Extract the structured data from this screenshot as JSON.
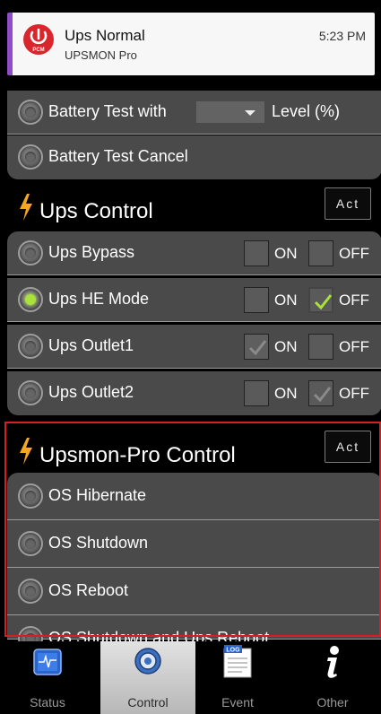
{
  "notification": {
    "title": "Ups Normal",
    "subtitle": "UPSMON Pro",
    "time": "5:23 PM",
    "icon_text": "PCM",
    "accent": "#8e4dc7"
  },
  "battery": {
    "test_with_prefix": "Battery Test with",
    "test_with_suffix": "Level (%)",
    "dropdown_value": "",
    "test_cancel": "Battery Test Cancel"
  },
  "ups_control": {
    "title": "Ups Control",
    "act_label": "Act",
    "on_label": "ON",
    "off_label": "OFF",
    "items": [
      {
        "label": "Ups Bypass",
        "selected": false,
        "on_checked": false,
        "off_checked": false
      },
      {
        "label": "Ups HE Mode",
        "selected": true,
        "on_checked": false,
        "off_checked": true
      },
      {
        "label": "Ups Outlet1",
        "selected": false,
        "on_checked": true,
        "off_checked": false
      },
      {
        "label": "Ups Outlet2",
        "selected": false,
        "on_checked": false,
        "off_checked": true
      }
    ]
  },
  "upsmon_control": {
    "title": "Upsmon-Pro Control",
    "act_label": "Act",
    "items": [
      {
        "label": "OS Hibernate"
      },
      {
        "label": "OS Shutdown"
      },
      {
        "label": "OS Reboot"
      },
      {
        "label": "OS Shutdown and Ups Reboot"
      }
    ]
  },
  "nav": {
    "items": [
      {
        "label": "Status",
        "icon": "status-icon"
      },
      {
        "label": "Control",
        "icon": "gear-icon",
        "active": true
      },
      {
        "label": "Event",
        "icon": "log-icon",
        "icon_text": "LOG"
      },
      {
        "label": "Other",
        "icon": "info-icon"
      }
    ]
  },
  "colors": {
    "active_check": "#a8e23a",
    "header_bolt": "#f5a623",
    "highlight_border": "#d42020"
  }
}
